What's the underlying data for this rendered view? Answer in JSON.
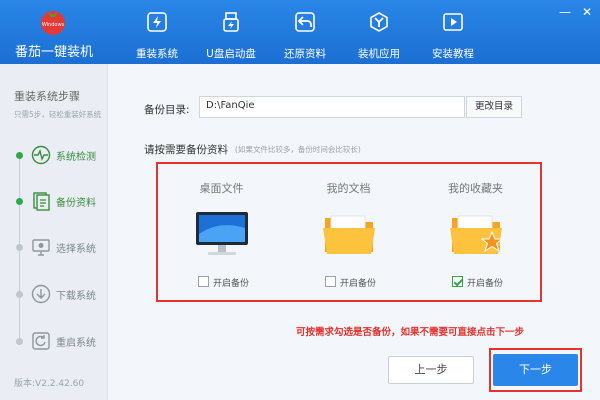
{
  "app": {
    "title": "番茄一键装机",
    "logo_text": "Windows"
  },
  "nav": {
    "items": [
      {
        "label": "重装系统",
        "icon": "lightning-icon"
      },
      {
        "label": "U盘启动盘",
        "icon": "usb-icon"
      },
      {
        "label": "还原资料",
        "icon": "restore-icon"
      },
      {
        "label": "装机应用",
        "icon": "apps-icon"
      },
      {
        "label": "安装教程",
        "icon": "play-icon"
      }
    ]
  },
  "window": {
    "minimize": "—",
    "close": "✕"
  },
  "sidebar": {
    "title": "重装系统步骤",
    "subtitle": "只需5步，轻松重装好系统",
    "steps": [
      {
        "label": "系统检测",
        "icon": "pulse-icon",
        "done": true
      },
      {
        "label": "备份资料",
        "icon": "document-icon",
        "done": true
      },
      {
        "label": "选择系统",
        "icon": "monitor-icon",
        "done": false
      },
      {
        "label": "下载系统",
        "icon": "download-icon",
        "done": false
      },
      {
        "label": "重启系统",
        "icon": "restart-icon",
        "done": false
      }
    ],
    "version": "版本:V2.2.42.60"
  },
  "main": {
    "backup_dir_label": "备份目录:",
    "backup_dir_value": "D:\\FanQie",
    "change_dir_button": "更改目录",
    "select_title": "请按需要备份资料",
    "select_hint": "(如果文件比较多，备份时间会比较长)",
    "options": [
      {
        "title": "桌面文件",
        "icon": "desktop-monitor-icon",
        "check_label": "开启备份",
        "checked": false
      },
      {
        "title": "我的文档",
        "icon": "folder-icon",
        "check_label": "开启备份",
        "checked": false
      },
      {
        "title": "我的收藏夹",
        "icon": "star-folder-icon",
        "check_label": "开启备份",
        "checked": true
      }
    ],
    "notice": "可按需求勾选是否备份，如果不需要可直接点击下一步",
    "prev_button": "上一步",
    "next_button": "下一步"
  },
  "colors": {
    "accent": "#2a86e8",
    "highlight": "#e3342f",
    "done": "#2fa84a"
  }
}
